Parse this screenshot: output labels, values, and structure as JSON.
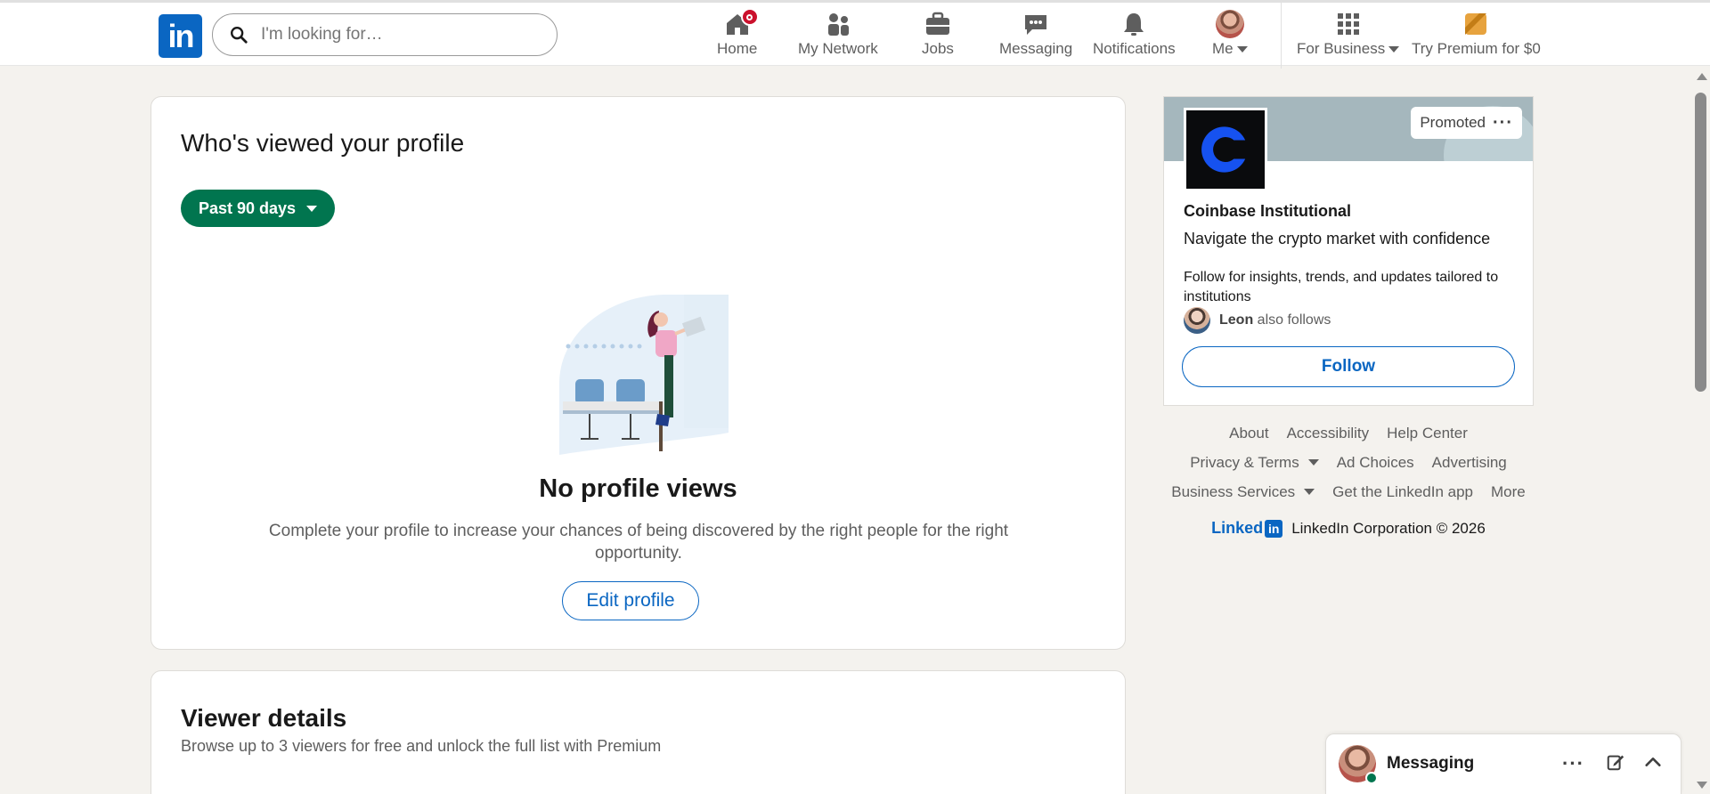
{
  "nav": {
    "search_placeholder": "I'm looking for…",
    "home": "Home",
    "network": "My Network",
    "jobs": "Jobs",
    "messaging": "Messaging",
    "notifications": "Notifications",
    "me": "Me",
    "for_business": "For Business",
    "premium": "Try Premium for $0"
  },
  "main": {
    "title": "Who's viewed your profile",
    "filter": "Past 90 days",
    "empty_title": "No profile views",
    "empty_desc": "Complete your profile to increase your chances of being discovered by the right people for the right opportunity.",
    "edit_button": "Edit profile"
  },
  "viewer": {
    "title": "Viewer details",
    "subtitle": "Browse up to 3 viewers for free and unlock the full list with Premium"
  },
  "ad": {
    "promoted": "Promoted",
    "company": "Coinbase Institutional",
    "headline": "Navigate the crypto market with confidence",
    "body": "Follow for insights, trends, and updates tailored to institutions",
    "follower_name": "Leon",
    "follower_suffix": "also follows",
    "follow_button": "Follow"
  },
  "footer": {
    "about": "About",
    "accessibility": "Accessibility",
    "help": "Help Center",
    "privacy": "Privacy & Terms",
    "ad_choices": "Ad Choices",
    "advertising": "Advertising",
    "business": "Business Services",
    "get_app": "Get the LinkedIn app",
    "more": "More",
    "brand_word": "Linked",
    "brand_in": "in",
    "copyright": "LinkedIn Corporation © 2026"
  },
  "messaging": {
    "label": "Messaging"
  },
  "colors": {
    "brand": "#0a66c2",
    "green": "#01754f",
    "badge": "#cb112d"
  }
}
